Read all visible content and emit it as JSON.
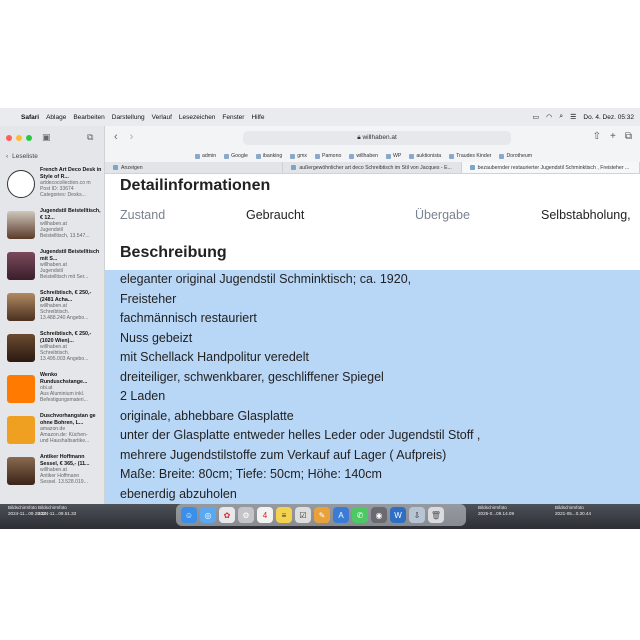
{
  "menubar": {
    "apple": "",
    "items": [
      "Safari",
      "Ablage",
      "Bearbeiten",
      "Darstellung",
      "Verlauf",
      "Lesezeichen",
      "Fenster",
      "Hilfe"
    ],
    "datetime": "Do. 4. Dez.  05:32"
  },
  "browser": {
    "url": "willhaben.at",
    "favorites": [
      "admin",
      "Google",
      "ibanking",
      "gmx",
      "Pamono",
      "willhaben",
      "WP",
      "auktionista",
      "Traudes Kinder",
      "Dorotheum"
    ],
    "tabs": [
      {
        "title": "Anzeigen"
      },
      {
        "title": "außergewöhnlicher art deco Schreibtisch im Stil von Jacques - E..."
      },
      {
        "title": "bezaubernder restaurierter Jugendstil Schminktisch , Freisteher ..."
      }
    ]
  },
  "sidebar": {
    "heading": "Leseliste",
    "items": [
      {
        "title": "French Art Deco Desk in Style of R...",
        "lines": [
          "artdecocollection.co m",
          "Post ID: 33674",
          "Categories: Desks..."
        ]
      },
      {
        "title": "Jugendstil Beistelltisch, € 12...",
        "lines": [
          "willhaben.at",
          "Jugendstil",
          "Beistelltisch, 13.547..."
        ]
      },
      {
        "title": "Jugendstil Beistelltisch mit S...",
        "lines": [
          "willhaben.at",
          "Jugendstil",
          "Beistelltisch mit Ser..."
        ]
      },
      {
        "title": "Schreibtisch, € 250,- (2481 Acha...",
        "lines": [
          "willhaben.at",
          "Schreibtisch.",
          "13.488.240 Angebo..."
        ]
      },
      {
        "title": "Schreibtisch, € 250,- (1020 Wien)...",
        "lines": [
          "willhaben.at",
          "Schreibtisch.",
          "13.495.003 Angebo..."
        ]
      },
      {
        "title": "Wenko Runduschstange...",
        "lines": [
          "obi.at",
          "Aus Aluminium inkl.",
          "Befestigungsmateri..."
        ]
      },
      {
        "title": "Duschvorhangstan ge ohne Bohren, L...",
        "lines": [
          "amazon.de",
          "Amazon.de: Küchen-",
          "und Haushaltsartike..."
        ]
      },
      {
        "title": "Antiker Hoffmann Sessel, € 365,- (11...",
        "lines": [
          "willhaben.at",
          "Antiker Hoffmann",
          "Sessel. 13.528.019..."
        ]
      }
    ]
  },
  "page": {
    "title": "Detailinformationen",
    "fields": [
      {
        "key": "Zustand",
        "value": "Gebraucht"
      },
      {
        "key": "Übergabe",
        "value": "Selbstabholung,"
      }
    ],
    "desc_title": "Beschreibung",
    "desc_lines": [
      "eleganter original Jugendstil Schminktisch; ca. 1920,",
      "Freisteher",
      "fachmännisch restauriert",
      "Nuss gebeizt",
      "mit Schellack Handpolitur veredelt",
      "dreiteiliger, schwenkbarer, geschliffener Spiegel",
      "2 Laden",
      "originale, abhebbare Glasplatte",
      "unter der Glasplatte entweder helles Leder oder Jugendstil Stoff ,",
      "mehrere Jugendstilstoffe zum Verkauf auf Lager ( Aufpreis)",
      "Maße: Breite: 80cm; Tiefe: 50cm; Höhe: 140cm",
      "ebenerdig abzuholen"
    ]
  },
  "desktop": {
    "files": [
      {
        "name": "Bildschirmfoto",
        "date": "2024-11...09.28.33"
      },
      {
        "name": "Bildschirmfoto",
        "date": "2024-11...09.51.33"
      },
      {
        "name": "Bildschirmfoto",
        "date": "2025-0...09.14.09"
      },
      {
        "name": "Bildschirmfoto",
        "date": "2021-05...0.30.44"
      }
    ],
    "dock_calendar_day": "4"
  },
  "colors": {
    "selection": "#b8d6f6",
    "key_text": "#7a8291",
    "sidebar_bg": "#e4e6e9"
  }
}
